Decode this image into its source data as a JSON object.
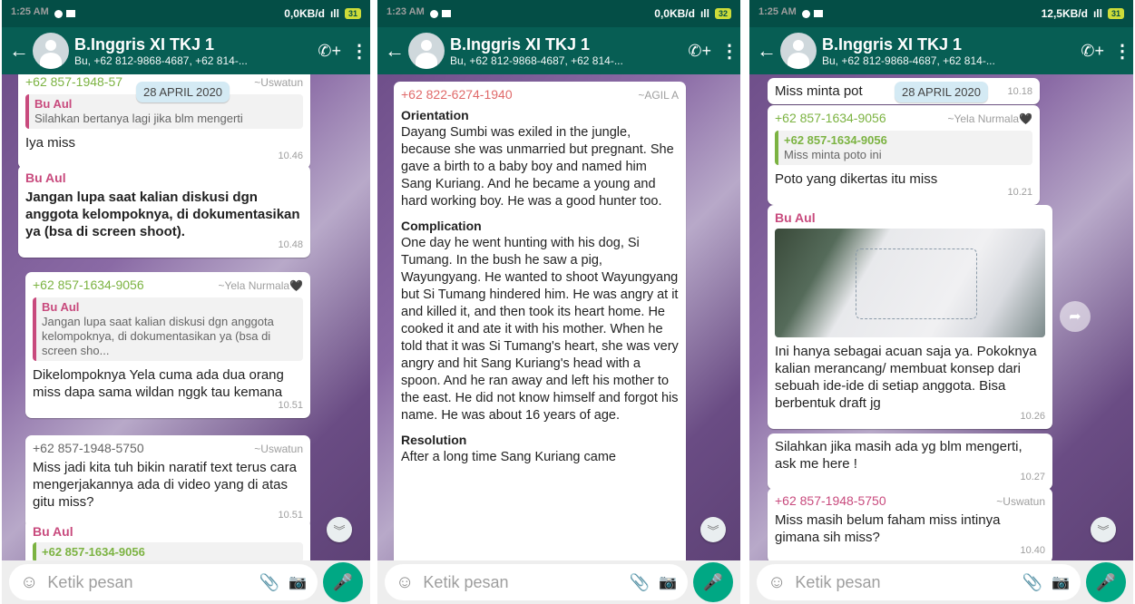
{
  "screens": [
    {
      "status": {
        "time": "1:25 AM",
        "speed": "0,0KB/d",
        "battery": "31"
      },
      "header": {
        "title": "B.Inggris XI TKJ 1",
        "subtitle": "Bu, +62 812-9868-4687, +62 814-..."
      },
      "date_chip": "28 APRIL 2020",
      "messages": [
        {
          "type": "reply",
          "sender": "+62 857-1948-57",
          "alias": "~Uswatun",
          "quote_sender": "Bu Aul",
          "quote_text": "Silahkan bertanya lagi jika blm mengerti",
          "text": "Iya miss",
          "time": "10.46"
        },
        {
          "type": "text",
          "sender": "Bu Aul",
          "text": "Jangan lupa saat kalian diskusi dgn anggota kelompoknya, di dokumentasikan ya (bsa di screen shoot).",
          "time": "10.48"
        },
        {
          "type": "reply",
          "sender": "+62 857-1634-9056",
          "alias": "~Yela Nurmala🖤",
          "quote_sender": "Bu Aul",
          "quote_text": "Jangan lupa saat kalian diskusi dgn anggota kelompoknya, di dokumentasikan ya (bsa di screen sho...",
          "text": "Dikelompoknya Yela cuma ada dua orang miss dapa sama wildan nggk tau kemana",
          "time": "10.51"
        },
        {
          "type": "text",
          "sender": "+62 857-1948-5750",
          "alias": "~Uswatun",
          "text": "Miss jadi kita tuh bikin naratif text terus cara mengerjakannya ada di video yang di atas gitu miss?",
          "time": "10.51"
        },
        {
          "type": "partial",
          "sender": "Bu Aul",
          "quote_sender": "+62 857-1634-9056"
        }
      ],
      "input_placeholder": "Ketik pesan"
    },
    {
      "status": {
        "time": "1:23 AM",
        "speed": "0,0KB/d",
        "battery": "32"
      },
      "header": {
        "title": "B.Inggris XI TKJ 1",
        "subtitle": "Bu, +62 812-9868-4687, +62 814-..."
      },
      "story": {
        "sender": "+62 822-6274-1940",
        "alias": "~AGIL A",
        "sections": [
          {
            "heading": "Orientation",
            "text": "Dayang Sumbi was exiled in the jungle, because she was unmarried but pregnant. She gave a birth to a baby boy and named him Sang Kuriang. And he became a young and hard working boy. He was a good hunter too."
          },
          {
            "heading": "Complication",
            "text": "One day he went hunting with his dog, Si Tumang. In the bush he saw a pig, Wayungyang. He wanted to shoot Wayungyang but Si Tumang hindered him. He was angry at it and killed it, and then took its heart home. He cooked it and ate it with his mother. When he told that it was Si Tumang's heart, she was very angry and hit Sang Kuriang's head with a spoon. And he ran away and left his mother to the east. He did not know himself and forgot his name. He was about 16 years of age."
          },
          {
            "heading": "Resolution",
            "text": "After a long time Sang Kuriang came"
          }
        ]
      },
      "input_placeholder": "Ketik pesan"
    },
    {
      "status": {
        "time": "1:25 AM",
        "speed": "12,5KB/d",
        "battery": "31"
      },
      "header": {
        "title": "B.Inggris XI TKJ 1",
        "subtitle": "Bu, +62 812-9868-4687, +62 814-..."
      },
      "date_chip": "28 APRIL 2020",
      "messages": [
        {
          "type": "text",
          "text": "Miss minta pot",
          "time": "10.18"
        },
        {
          "type": "reply",
          "sender": "+62 857-1634-9056",
          "alias": "~Yela Nurmala🖤",
          "quote_sender": "+62 857-1634-9056",
          "quote_text": "Miss minta poto ini",
          "text": "Poto yang dikertas itu miss",
          "time": "10.21"
        },
        {
          "type": "image",
          "sender": "Bu Aul",
          "text": "Ini hanya sebagai acuan saja ya. Pokoknya kalian merancang/ membuat konsep dari sebuah ide-ide di setiap anggota. Bisa berbentuk draft jg",
          "time": "10.26"
        },
        {
          "type": "text",
          "text": "Silahkan jika masih ada yg blm mengerti, ask me here !",
          "time": "10.27"
        },
        {
          "type": "text",
          "sender": "+62 857-1948-5750",
          "alias": "~Uswatun",
          "text": "Miss masih belum faham miss intinya gimana sih miss?",
          "time": "10.40"
        }
      ],
      "input_placeholder": "Ketik pesan"
    }
  ],
  "icons": {
    "back": "←",
    "call_add": "✆+",
    "menu": "⋮",
    "emoji": "☺",
    "attach": "📎",
    "camera": "📷",
    "mic": "🎤",
    "scroll_down": "︾",
    "share": "➦"
  },
  "colors": {
    "header": "#075e54",
    "statusbar": "#044e46",
    "accent_green": "#00a884",
    "sender_pink": "#c84a7d",
    "sender_green": "#7cb342"
  }
}
